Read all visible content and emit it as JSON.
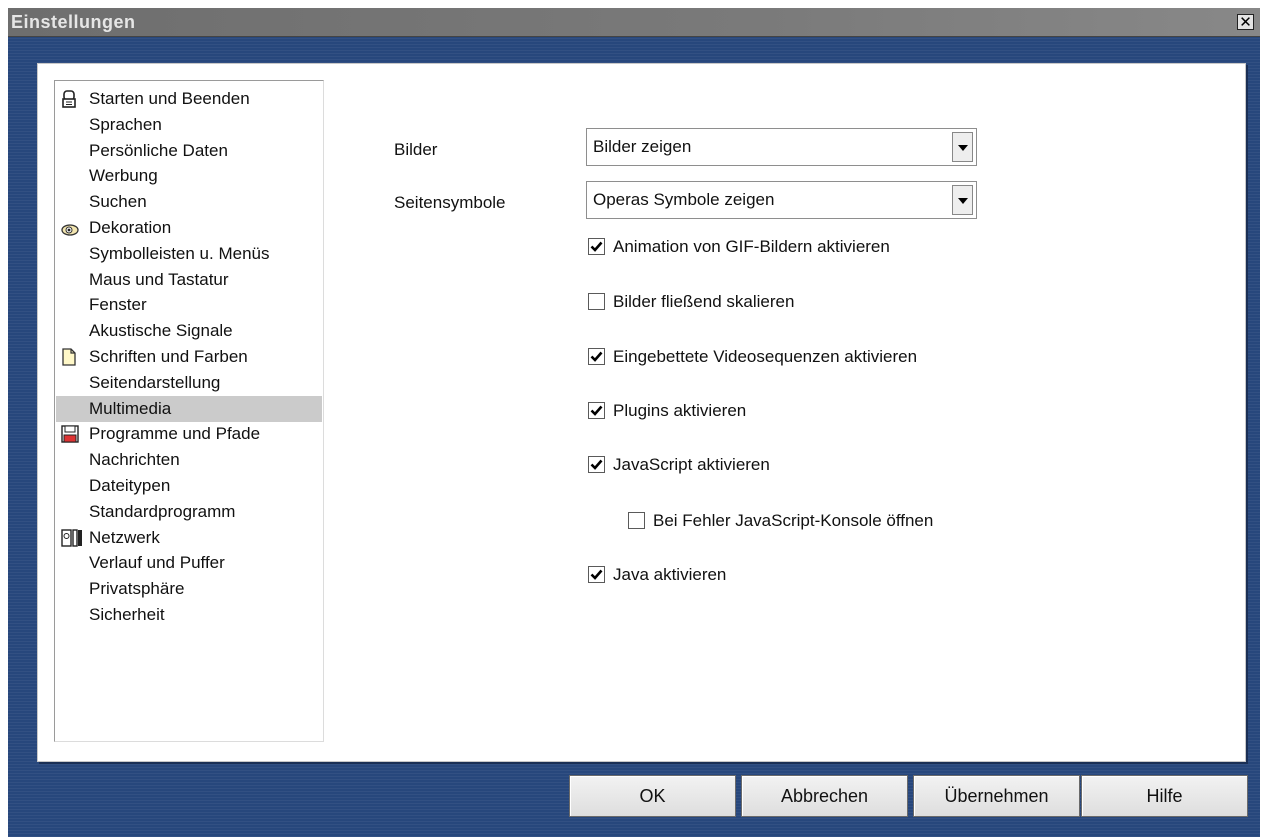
{
  "window": {
    "title": "Einstellungen",
    "close_symbol": "✕"
  },
  "categories": [
    {
      "label": "Starten und Beenden",
      "icon": "startup-icon"
    },
    {
      "label": "Sprachen"
    },
    {
      "label": "Persönliche Daten"
    },
    {
      "label": "Werbung"
    },
    {
      "label": "Suchen"
    },
    {
      "label": "Dekoration",
      "icon": "eye-icon"
    },
    {
      "label": "Symbolleisten u. Menüs"
    },
    {
      "label": "Maus und Tastatur"
    },
    {
      "label": "Fenster"
    },
    {
      "label": "Akustische Signale"
    },
    {
      "label": "Schriften und Farben",
      "icon": "document-icon"
    },
    {
      "label": "Seitendarstellung"
    },
    {
      "label": "Multimedia",
      "selected": true
    },
    {
      "label": "Programme und Pfade",
      "icon": "floppy-disk-icon"
    },
    {
      "label": "Nachrichten"
    },
    {
      "label": "Dateitypen"
    },
    {
      "label": "Standardprogramm"
    },
    {
      "label": "Netzwerk",
      "icon": "network-icon"
    },
    {
      "label": "Verlauf und Puffer"
    },
    {
      "label": "Privatsphäre"
    },
    {
      "label": "Sicherheit"
    }
  ],
  "multimedia": {
    "images_label": "Bilder",
    "images_value": "Bilder zeigen",
    "page_icons_label": "Seitensymbole",
    "page_icons_value": "Operas Symbole zeigen",
    "options": [
      {
        "label": "Animation von GIF-Bildern aktivieren",
        "checked": true
      },
      {
        "label": "Bilder fließend skalieren",
        "checked": false
      },
      {
        "label": "Eingebettete Videosequenzen aktivieren",
        "checked": true
      },
      {
        "label": "Plugins aktivieren",
        "checked": true
      },
      {
        "label": "JavaScript aktivieren",
        "checked": true
      },
      {
        "label": "Bei Fehler JavaScript-Konsole öffnen",
        "checked": false,
        "indent": true
      },
      {
        "label": "Java aktivieren",
        "checked": true
      }
    ]
  },
  "buttons": {
    "ok": "OK",
    "cancel": "Abbrechen",
    "apply": "Übernehmen",
    "help": "Hilfe"
  }
}
